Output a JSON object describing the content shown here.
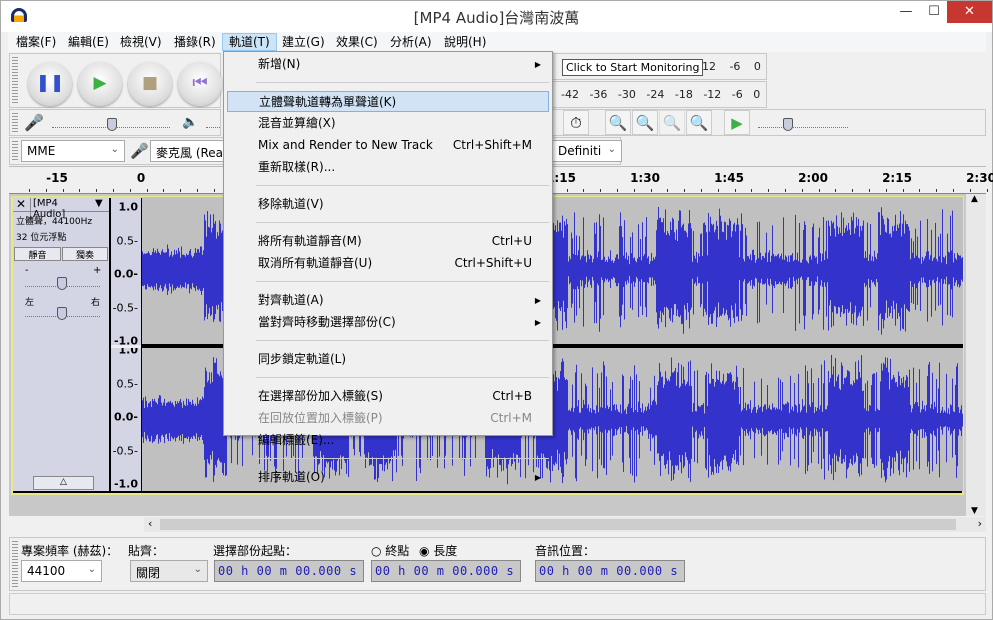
{
  "window": {
    "title": "[MP4 Audio]台灣南波萬",
    "minimize": "—",
    "maximize": "☐",
    "close": "✕"
  },
  "menubar": [
    "檔案(F)",
    "編輯(E)",
    "檢視(V)",
    "播錄(R)",
    "軌道(T)",
    "建立(G)",
    "效果(C)",
    "分析(A)",
    "說明(H)"
  ],
  "transport": {
    "pause": "pause-icon",
    "play": "play-icon",
    "stop": "stop-icon",
    "skip_start": "skip-start-icon"
  },
  "meters": {
    "tooltip": "Click to Start Monitoring",
    "rec_ticks": [
      "-12",
      "-6",
      "0"
    ],
    "play_ticks": [
      "-42",
      "-36",
      "-30",
      "-24",
      "-18",
      "-12",
      "-6",
      "0"
    ]
  },
  "devices": {
    "host": "MME",
    "input": "麥克風 (Real",
    "output": "Definiti"
  },
  "ruler": [
    {
      "t": "-15",
      "s": -15
    },
    {
      "t": "0",
      "s": 0
    },
    {
      "t": "1:15",
      "s": 75
    },
    {
      "t": "1:30",
      "s": 90
    },
    {
      "t": "1:45",
      "s": 105
    },
    {
      "t": "2:00",
      "s": 120
    },
    {
      "t": "2:15",
      "s": 135
    },
    {
      "t": "2:30",
      "s": 150
    }
  ],
  "track": {
    "name": "[MP4 Audio]",
    "info1": "立體聲，44100Hz",
    "info2": "32 位元浮點",
    "mute": "靜音",
    "solo": "獨奏",
    "gain_minus": "-",
    "gain_plus": "+",
    "pan_left": "左",
    "pan_right": "右",
    "scale": [
      "1.0",
      "0.5-",
      "0.0-",
      "-0.5-",
      "-1.0"
    ]
  },
  "menu": {
    "items": [
      {
        "label": "新增(N)",
        "submenu": true
      },
      {
        "sep": true
      },
      {
        "label": "立體聲軌道轉為單聲道(K)",
        "highlight": true
      },
      {
        "label": "混音並算繪(X)"
      },
      {
        "label": "Mix and Render to New Track",
        "shortcut": "Ctrl+Shift+M"
      },
      {
        "label": "重新取樣(R)..."
      },
      {
        "sep": true
      },
      {
        "label": "移除軌道(V)"
      },
      {
        "sep": true
      },
      {
        "label": "將所有軌道靜音(M)",
        "shortcut": "Ctrl+U"
      },
      {
        "label": "取消所有軌道靜音(U)",
        "shortcut": "Ctrl+Shift+U"
      },
      {
        "sep": true
      },
      {
        "label": "對齊軌道(A)",
        "submenu": true
      },
      {
        "label": "當對齊時移動選擇部份(C)",
        "submenu": true
      },
      {
        "sep": true
      },
      {
        "label": "同步鎖定軌道(L)"
      },
      {
        "sep": true
      },
      {
        "label": "在選擇部份加入標籤(S)",
        "shortcut": "Ctrl+B"
      },
      {
        "label": "在回放位置加入標籤(P)",
        "shortcut": "Ctrl+M",
        "disabled": true
      },
      {
        "label": "編輯標籤(E)..."
      },
      {
        "sep": true
      },
      {
        "label": "排序軌道(O)",
        "submenu": true
      }
    ]
  },
  "bottom": {
    "rate_label": "專案頻率 (赫茲)：",
    "rate": "44100",
    "snap_label": "貼齊：",
    "snap": "關閉",
    "sel_start_label": "選擇部份起點：",
    "end_label": "終點",
    "length_label": "長度",
    "length_selected": true,
    "pos_label": "音訊位置：",
    "time1": "00 h 00 m 00.000 s",
    "time2": "00 h 00 m 00.000 s",
    "time3": "00 h 00 m 00.000 s"
  },
  "colors": {
    "wave": "#3333cc",
    "track_bg": "#c0c0c0",
    "selected_border": "#e8e888",
    "close": "#c7372f"
  }
}
